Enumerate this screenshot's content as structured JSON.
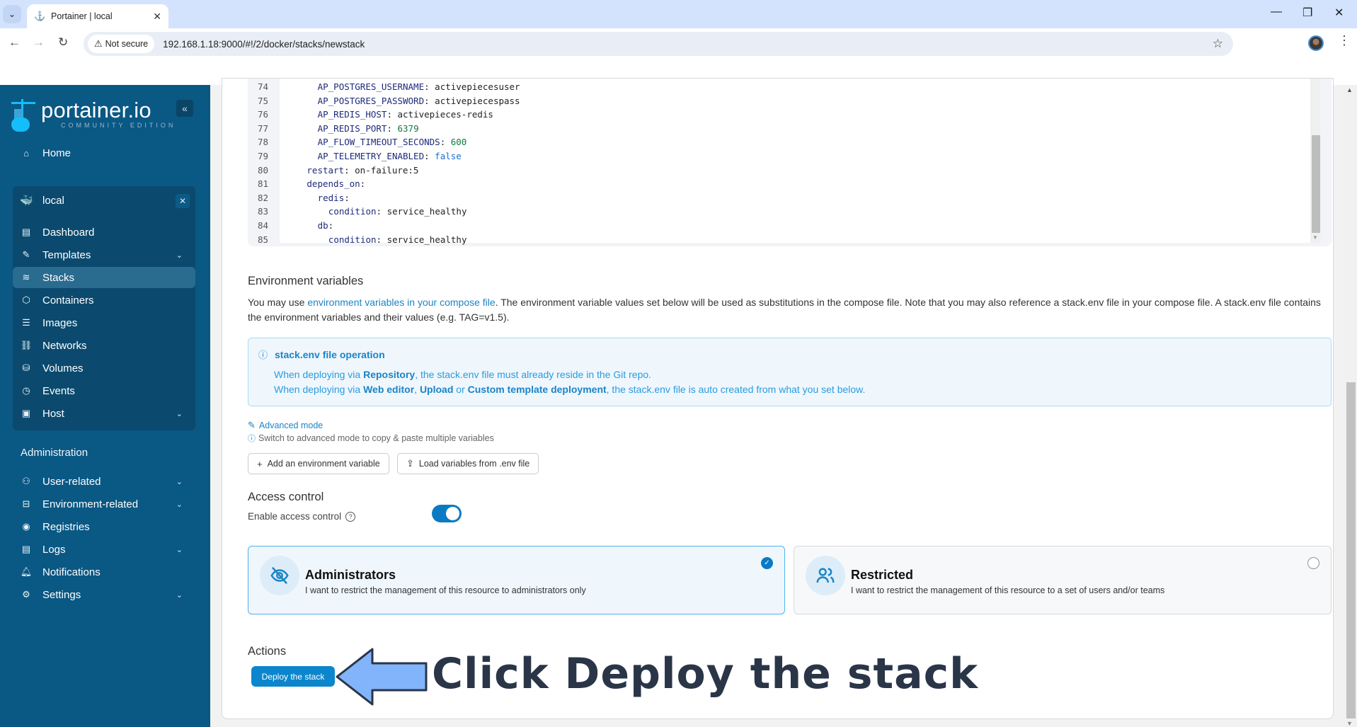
{
  "browser": {
    "tab_title": "Portainer | local",
    "security_label": "Not secure",
    "url": "192.168.1.18:9000/#!/2/docker/stacks/newstack"
  },
  "sidebar": {
    "brand": "portainer.io",
    "edition": "COMMUNITY EDITION",
    "home": "Home",
    "environment": "local",
    "env_items": [
      {
        "label": "Dashboard",
        "icon": "dashboard-icon"
      },
      {
        "label": "Templates",
        "icon": "edit-icon",
        "expandable": true
      },
      {
        "label": "Stacks",
        "icon": "layers-icon",
        "active": true
      },
      {
        "label": "Containers",
        "icon": "box-icon"
      },
      {
        "label": "Images",
        "icon": "list-icon"
      },
      {
        "label": "Networks",
        "icon": "network-icon"
      },
      {
        "label": "Volumes",
        "icon": "database-icon"
      },
      {
        "label": "Events",
        "icon": "clock-icon"
      },
      {
        "label": "Host",
        "icon": "host-icon",
        "expandable": true
      }
    ],
    "admin_heading": "Administration",
    "admin_items": [
      {
        "label": "User-related",
        "icon": "users-icon",
        "expandable": true
      },
      {
        "label": "Environment-related",
        "icon": "drive-icon",
        "expandable": true
      },
      {
        "label": "Registries",
        "icon": "radio-icon"
      },
      {
        "label": "Logs",
        "icon": "file-icon",
        "expandable": true
      },
      {
        "label": "Notifications",
        "icon": "bell-icon"
      },
      {
        "label": "Settings",
        "icon": "gear-icon",
        "expandable": true
      }
    ]
  },
  "editor": {
    "lines": [
      {
        "n": "74",
        "indent": 6,
        "key": "AP_POSTGRES_USERNAME",
        "value": "activepiecesuser",
        "vtype": "str"
      },
      {
        "n": "75",
        "indent": 6,
        "key": "AP_POSTGRES_PASSWORD",
        "value": "activepiecespass",
        "vtype": "str"
      },
      {
        "n": "76",
        "indent": 6,
        "key": "AP_REDIS_HOST",
        "value": "activepieces-redis",
        "vtype": "str"
      },
      {
        "n": "77",
        "indent": 6,
        "key": "AP_REDIS_PORT",
        "value": "6379",
        "vtype": "num"
      },
      {
        "n": "78",
        "indent": 6,
        "key": "AP_FLOW_TIMEOUT_SECONDS",
        "value": "600",
        "vtype": "num"
      },
      {
        "n": "79",
        "indent": 6,
        "key": "AP_TELEMETRY_ENABLED",
        "value": "false",
        "vtype": "bool"
      },
      {
        "n": "80",
        "indent": 4,
        "key": "restart",
        "value": "on-failure:5",
        "vtype": "str"
      },
      {
        "n": "81",
        "indent": 4,
        "key": "depends_on",
        "value": "",
        "vtype": "str"
      },
      {
        "n": "82",
        "indent": 6,
        "key": "redis",
        "value": "",
        "vtype": "str"
      },
      {
        "n": "83",
        "indent": 8,
        "key": "condition",
        "value": "service_healthy",
        "vtype": "str"
      },
      {
        "n": "84",
        "indent": 6,
        "key": "db",
        "value": "",
        "vtype": "str"
      },
      {
        "n": "85",
        "indent": 8,
        "key": "condition",
        "value": "service_healthy",
        "vtype": "str"
      }
    ]
  },
  "env_vars": {
    "heading": "Environment variables",
    "intro_prefix": "You may use ",
    "intro_link": "environment variables in your compose file",
    "intro_suffix": ". The environment variable values set below will be used as substitutions in the compose file. Note that you may also reference a stack.env file in your compose file. A stack.env file contains the environment variables and their values (e.g. TAG=v1.5).",
    "info_title": "stack.env file operation",
    "info_l1_a": "When deploying via ",
    "info_l1_b": "Repository",
    "info_l1_c": ", the stack.env file must already reside in the Git repo.",
    "info_l2_a": "When deploying via ",
    "info_l2_b": "Web editor",
    "info_l2_c": ", ",
    "info_l2_d": "Upload",
    "info_l2_e": " or ",
    "info_l2_f": "Custom template deployment",
    "info_l2_g": ", the stack.env file is auto created from what you set below.",
    "advanced_mode": "Advanced mode",
    "advanced_hint": "Switch to advanced mode to copy & paste multiple variables",
    "add_button": "Add an environment variable",
    "load_button": "Load variables from .env file"
  },
  "access_control": {
    "heading": "Access control",
    "toggle_label": "Enable access control",
    "toggle_on": true,
    "options": [
      {
        "title": "Administrators",
        "desc": "I want to restrict the management of this resource to administrators only",
        "selected": true
      },
      {
        "title": "Restricted",
        "desc": "I want to restrict the management of this resource to a set of users and/or teams",
        "selected": false
      }
    ]
  },
  "actions": {
    "heading": "Actions",
    "deploy_button": "Deploy the stack"
  },
  "annotation": {
    "text": "Click Deploy the stack"
  }
}
